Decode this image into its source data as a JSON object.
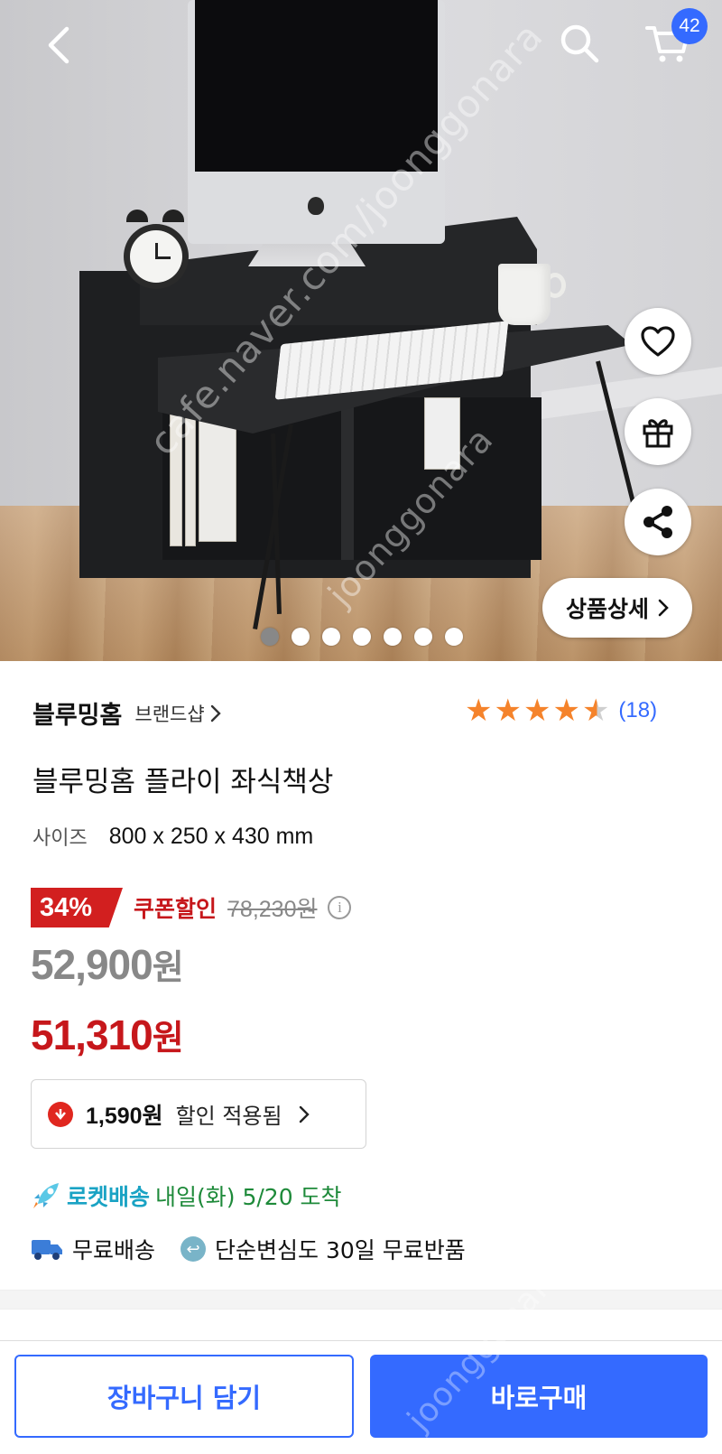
{
  "hero": {
    "watermark_1": "cafe.naver.com/joonggonara",
    "watermark_2": "joonggonara",
    "detail_button_label": "상품상세",
    "carousel": {
      "total": 7,
      "active_index": 0
    }
  },
  "header": {
    "cart_count": "42",
    "icons": {
      "back": "back-arrow-icon",
      "search": "search-icon",
      "cart": "cart-icon"
    }
  },
  "side_actions": {
    "icons": [
      "heart-icon",
      "gift-icon",
      "share-icon"
    ]
  },
  "product": {
    "brand": "블루밍홈",
    "brand_shop_label": "브랜드샵",
    "rating": 4.5,
    "rating_count": "(18)",
    "title": "블루밍홈 플라이 좌식책상",
    "option_label": "사이즈",
    "option_value": "800 x 250 x 430 mm"
  },
  "pricing": {
    "discount_rate": "34%",
    "coupon_label": "쿠폰할인",
    "original_price": "78,230원",
    "sale_price_number": "52,900",
    "coupon_price_number": "51,310",
    "currency": "원",
    "coupon_discount_amount": "1,590원",
    "coupon_applied_text": "할인 적용됨"
  },
  "delivery": {
    "rocket_label": "로켓배송",
    "arrival_text": "내일(화) 5/20 도착",
    "free_shipping": "무료배송",
    "return_policy": "단순변심도 30일 무료반품"
  },
  "bottom_bar": {
    "add_to_cart": "장바구니 담기",
    "buy_now": "바로구매"
  },
  "colors": {
    "accent_blue": "#346aff",
    "discount_red": "#c6171b",
    "star_orange": "#f5832b",
    "rocket_teal": "#1aa3c4",
    "arrival_green": "#1e8a3a"
  }
}
